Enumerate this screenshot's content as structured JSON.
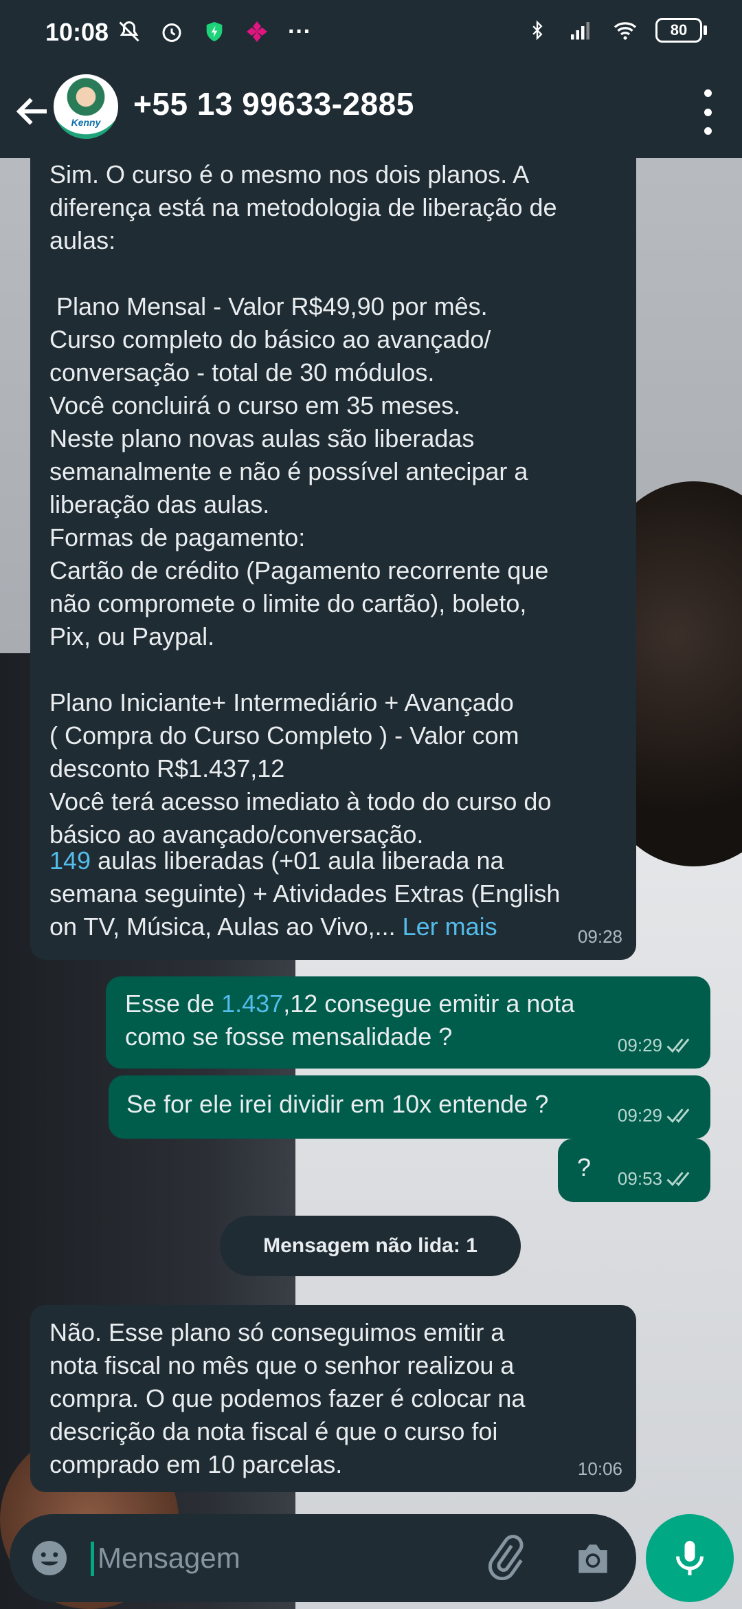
{
  "status_bar": {
    "time": "10:08",
    "dots": "···",
    "battery": "80"
  },
  "header": {
    "contact_name": "+55 13 99633-2885",
    "avatar_text": "Kenny"
  },
  "messages": [
    {
      "direction": "incoming",
      "text": "Sim. O curso é o mesmo nos dois planos. A\ndiferença está na metodologia de liberação de\naulas:\n\n Plano Mensal - Valor R$49,90 por mês.\nCurso completo do básico ao avançado/\nconversação - total de 30 módulos.\nVocê concluirá o curso em 35 meses.\nNeste plano novas aulas são liberadas\nsemanalmente e não é possível antecipar a\nliberação das aulas.\nFormas de pagamento:\nCartão de crédito (Pagamento recorrente que\nnão compromete o limite do cartão), boleto,\nPix, ou Paypal.\n\nPlano Iniciante+ Intermediário + Avançado\n( Compra do Curso Completo ) - Valor com\ndesconto R$1.437,12\nVocê terá acesso imediato à todo do curso do\nbásico ao avançado/conversação.",
      "highlight_number": "149",
      "tail_text_1": " aulas liberadas (+01 aula liberada na\nsemana seguinte) + Atividades Extras (English\non TV, Música, Aulas ao Vivo,... ",
      "read_more": "Ler mais",
      "time": "09:28"
    },
    {
      "direction": "outgoing",
      "text_prefix": "Esse de ",
      "highlight_number": "1.437",
      "text_suffix": ",12 consegue emitir a nota\ncomo se fosse mensalidade ?",
      "time": "09:29"
    },
    {
      "direction": "outgoing",
      "text": "Se for ele irei dividir em 10x entende ?",
      "time": "09:29"
    },
    {
      "direction": "outgoing",
      "text": "?",
      "time": "09:53"
    },
    {
      "direction": "incoming",
      "text": "Não. Esse plano só conseguimos emitir a\nnota fiscal no mês que o senhor realizou a\ncompra. O que podemos fazer é colocar na\ndescrição da nota fiscal é que o curso foi\ncomprado em 10 parcelas.",
      "time": "10:06"
    }
  ],
  "unread_divider": "Mensagem não lida: 1",
  "composer": {
    "placeholder": "Mensagem"
  },
  "colors": {
    "incoming_bubble": "#202c33",
    "outgoing_bubble": "#005c4b",
    "accent": "#00a884",
    "link": "#53bdeb"
  },
  "icons": [
    "mute-icon",
    "alarm-icon",
    "shield-icon",
    "app-icon",
    "bluetooth-icon",
    "signal-icon",
    "wifi-icon",
    "back-arrow-icon",
    "more-options-icon",
    "double-check-icon",
    "emoji-icon",
    "attach-icon",
    "camera-icon",
    "mic-icon"
  ]
}
